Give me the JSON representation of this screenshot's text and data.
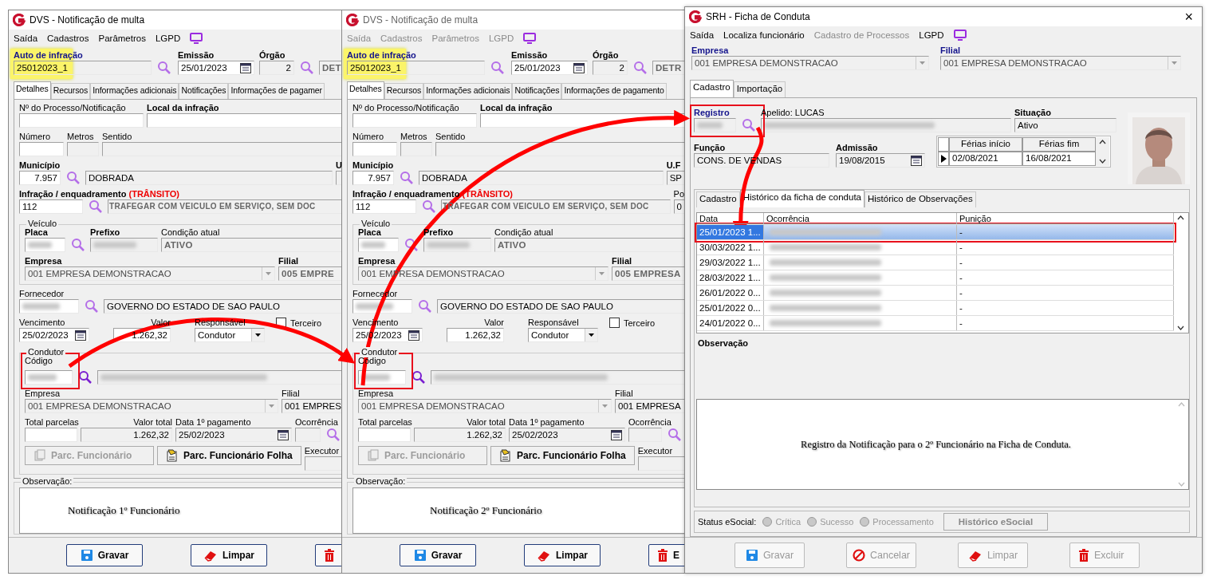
{
  "windows": [
    {
      "kind": "dvs",
      "title": "DVS - Notificação de multa",
      "menu": [
        {
          "label": "Saída",
          "disabled": false
        },
        {
          "label": "Cadastros",
          "disabled": false
        },
        {
          "label": "Parâmetros",
          "disabled": false
        },
        {
          "label": "LGPD",
          "disabled": false
        }
      ],
      "header": {
        "auto": {
          "label": "Auto de infração",
          "value": "25012023_1",
          "highlighted": true
        },
        "emissao": {
          "label": "Emissão",
          "value": "25/01/2023"
        },
        "orgao": {
          "label": "Órgão",
          "value": "2",
          "name": "DET"
        }
      },
      "tabs": [
        {
          "label": "Detalhes",
          "selected": true
        },
        {
          "label": "Recursos",
          "selected": false
        },
        {
          "label": "Informações adicionais",
          "selected": false
        },
        {
          "label": "Notificações",
          "selected": false
        },
        {
          "label": "Informações de pagamer",
          "selected": false
        }
      ],
      "details": {
        "processo_label": "Nº do Processo/Notificação",
        "local_label": "Local da infração",
        "numero_label": "Número",
        "metros_label": "Metros",
        "sentido_label": "Sentido",
        "municipio": {
          "label": "Município",
          "code": "7.957",
          "name": "DOBRADA"
        },
        "uf": {
          "label": "U"
        },
        "infracao": {
          "label": "Infração / enquadramento",
          "tag": "(TRÂNSITO)",
          "code": "112",
          "description": "TRAFEGAR COM VEICULO EM SERVIÇO, SEM DOC"
        },
        "veiculo": {
          "legend": "Veículo",
          "placa_label": "Placa",
          "prefixo_label": "Prefixo",
          "condicao_label": "Condição atual",
          "condicao_value": "ATIVO"
        },
        "empresa": {
          "label": "Empresa",
          "value": "001 EMPRESA DEMONSTRACAO"
        },
        "filial": {
          "label": "Filial",
          "value": "005 EMPRE"
        },
        "fornecedor": {
          "label": "Fornecedor",
          "name": "GOVERNO DO ESTADO DE SAO PAULO"
        },
        "vencimento": {
          "label": "Vencimento",
          "value": "25/02/2023"
        },
        "valor": {
          "label": "Valor",
          "value": "1.262,32"
        },
        "responsavel": {
          "label": "Responsável",
          "value": "Condutor"
        },
        "terceiro": {
          "label": "Terceiro",
          "checked": false
        },
        "condutor": {
          "legend": "Condutor",
          "codigo_label": "Código",
          "empresa_label": "Empresa",
          "empresa_value": "001 EMPRESA DEMONSTRACAO",
          "filial_label": "Filial",
          "filial_value": "001 EMPRES"
        },
        "total_parcelas_label": "Total parcelas",
        "valor_total": {
          "label": "Valor total",
          "value": "1.262,32"
        },
        "data_pagamento": {
          "label": "Data 1º pagamento",
          "value": "25/02/2023"
        },
        "ocorrencia_label": "Ocorrência",
        "executor_label": "Executor",
        "buttons": [
          {
            "label": "Parc. Funcionário",
            "disabled": true
          },
          {
            "label": "Parc. Funcionário Folha",
            "disabled": false
          }
        ],
        "observacao": {
          "legend": "Observação:",
          "text": "Notificação 1º Funcionário"
        }
      },
      "footer": [
        {
          "kind": "save",
          "label": "Gravar",
          "disabled": false
        },
        {
          "kind": "clear",
          "label": "Limpar",
          "disabled": false
        },
        {
          "kind": "delete",
          "disabled": false
        }
      ]
    },
    {
      "kind": "dvs",
      "title": "DVS - Notificação de multa",
      "menu": [
        {
          "label": "Saída",
          "disabled": true
        },
        {
          "label": "Cadastros",
          "disabled": true
        },
        {
          "label": "Parâmetros",
          "disabled": true
        },
        {
          "label": "LGPD",
          "disabled": true
        }
      ],
      "header": {
        "auto": {
          "label": "Auto de infração",
          "value": "25012023_1",
          "highlighted": true
        },
        "emissao": {
          "label": "Emissão",
          "value": "25/01/2023"
        },
        "orgao": {
          "label": "Órgão",
          "value": "2",
          "name": "DETR"
        }
      },
      "tabs": [
        {
          "label": "Detalhes",
          "selected": true
        },
        {
          "label": "Recursos",
          "selected": false
        },
        {
          "label": "Informações adicionais",
          "selected": false
        },
        {
          "label": "Notificações",
          "selected": false
        },
        {
          "label": "Informações de pagamento",
          "selected": false
        }
      ],
      "details": {
        "processo_label": "Nº do Processo/Notificação",
        "local_label": "Local da infração",
        "numero_label": "Número",
        "metros_label": "Metros",
        "sentido_label": "Sentido",
        "municipio": {
          "label": "Município",
          "code": "7.957",
          "name": "DOBRADA"
        },
        "uf": {
          "label": "U.F",
          "value": "SP"
        },
        "infracao": {
          "label": "Infração / enquadramento",
          "tag": "(TRÂNSITO)",
          "code": "112",
          "description": "TRAFEGAR COM VEICULO EM SERVIÇO, SEM DOC"
        },
        "extra": {
          "label": "Po",
          "value": "0"
        },
        "veiculo": {
          "legend": "Veículo",
          "placa_label": "Placa",
          "prefixo_label": "Prefixo",
          "condicao_label": "Condição atual",
          "condicao_value": "ATIVO"
        },
        "empresa": {
          "label": "Empresa",
          "value": "001 EMPRESA DEMONSTRACAO"
        },
        "filial": {
          "label": "Filial",
          "value": "005 EMPRESA"
        },
        "fornecedor": {
          "label": "Fornecedor",
          "name": "GOVERNO DO ESTADO DE SAO PAULO"
        },
        "vencimento": {
          "label": "Vencimento",
          "value": "25/02/2023"
        },
        "valor": {
          "label": "Valor",
          "value": "1.262,32"
        },
        "responsavel": {
          "label": "Responsável",
          "value": "Condutor"
        },
        "terceiro": {
          "label": "Terceiro",
          "checked": false
        },
        "condutor": {
          "legend": "Condutor",
          "codigo_label": "Código",
          "empresa_label": "Empresa",
          "empresa_value": "001 EMPRESA DEMONSTRACAO",
          "filial_label": "Filial",
          "filial_value": "001 EMPRESA"
        },
        "total_parcelas_label": "Total parcelas",
        "valor_total": {
          "label": "Valor total",
          "value": "1.262,32"
        },
        "data_pagamento": {
          "label": "Data 1º pagamento",
          "value": "25/02/2023"
        },
        "ocorrencia_label": "Ocorrência",
        "executor_label": "Executor",
        "buttons": [
          {
            "label": "Parc. Funcionário",
            "disabled": true
          },
          {
            "label": "Parc. Funcionário Folha",
            "disabled": false
          }
        ],
        "observacao": {
          "legend": "Observação:",
          "text": "Notificação 2º Funcionário"
        }
      },
      "footer": [
        {
          "kind": "save",
          "label": "Gravar",
          "disabled": false
        },
        {
          "kind": "clear",
          "label": "Limpar",
          "disabled": false
        },
        {
          "kind": "delete",
          "label": "E",
          "disabled": false
        }
      ]
    },
    {
      "kind": "srh",
      "title": "SRH - Ficha de Conduta",
      "close": "×",
      "menu": [
        {
          "label": "Saída",
          "disabled": false
        },
        {
          "label": "Localiza funcionário",
          "disabled": false
        },
        {
          "label": "Cadastro de Processos",
          "disabled": true
        },
        {
          "label": "LGPD",
          "disabled": false
        }
      ],
      "empresa": {
        "label": "Empresa",
        "value": "001 EMPRESA DEMONSTRACAO"
      },
      "filial": {
        "label": "Filial",
        "value": "001 EMPRESA DEMONSTRACAO"
      },
      "tabs": [
        {
          "label": "Cadastro",
          "selected": true
        },
        {
          "label": "Importação",
          "selected": false
        }
      ],
      "registro_label": "Registro",
      "apelido": "Apelido: LUCAS",
      "situacao": {
        "label": "Situação",
        "value": "Ativo"
      },
      "funcao": {
        "label": "Função",
        "value": "CONS. DE VENDAS"
      },
      "admissao": {
        "label": "Admissão",
        "value": "19/08/2015"
      },
      "ferias": {
        "columns": [
          "Férias início",
          "Férias fim"
        ],
        "rows": [
          {
            "cells": [
              "02/08/2021",
              "16/08/2021"
            ],
            "current": true
          }
        ]
      },
      "photo": {
        "kind": "picture"
      },
      "inner_tabs": [
        {
          "label": "Cadastro",
          "selected": false
        },
        {
          "label": "Histórico da ficha de conduta",
          "selected": true
        },
        {
          "label": "Histórico de Observações",
          "selected": false
        }
      ],
      "history": {
        "columns": [
          "Data",
          "Ocorrência",
          "Punição"
        ],
        "rows": [
          {
            "date": "25/01/2023 1...",
            "punishment": "-",
            "selected": true
          },
          {
            "date": "30/03/2022 1...",
            "punishment": "-",
            "selected": false
          },
          {
            "date": "29/03/2022 1...",
            "punishment": "-",
            "selected": false
          },
          {
            "date": "28/03/2022 1...",
            "punishment": "-",
            "selected": false
          },
          {
            "date": "26/01/2022 0...",
            "punishment": "-",
            "selected": false
          },
          {
            "date": "25/01/2022 0...",
            "punishment": "-",
            "selected": false
          },
          {
            "date": "24/01/2022 0...",
            "punishment": "-",
            "selected": false
          }
        ]
      },
      "observacao_label": "Observação",
      "observacao_text": "Registro da Notificação para o 2º Funcionário na Ficha de Conduta.",
      "esocial": {
        "label": "Status eSocial:",
        "disabled": true,
        "options": [
          {
            "label": "Crítica",
            "selected": false
          },
          {
            "label": "Sucesso",
            "selected": false
          },
          {
            "label": "Processamento",
            "selected": false
          }
        ],
        "button": "Histórico eSocial"
      },
      "footer": [
        {
          "kind": "save",
          "label": "Gravar",
          "disabled": true
        },
        {
          "kind": "cancel",
          "label": "Cancelar",
          "disabled": true
        },
        {
          "kind": "clear",
          "label": "Limpar",
          "disabled": true
        },
        {
          "kind": "delete",
          "label": "Excluir",
          "disabled": true
        }
      ]
    }
  ]
}
